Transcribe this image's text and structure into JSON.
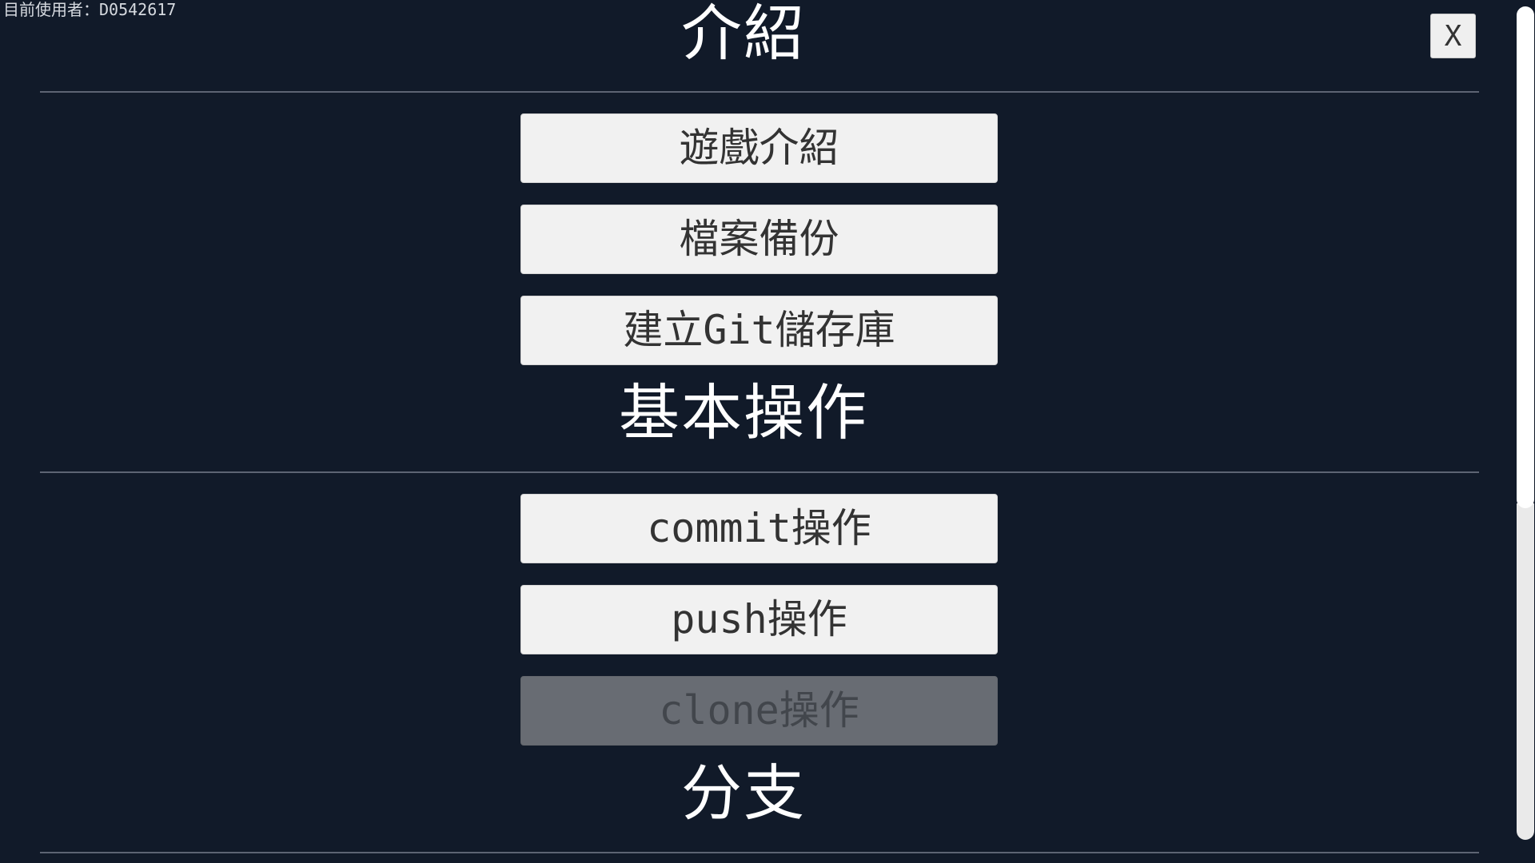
{
  "header": {
    "current_user": "目前使用者：D0542617",
    "close_label": "X"
  },
  "sections": [
    {
      "title": "介紹",
      "buttons": [
        {
          "label": "遊戲介紹",
          "enabled": true
        },
        {
          "label": "檔案備份",
          "enabled": true
        },
        {
          "label": "建立Git儲存庫",
          "enabled": true
        }
      ]
    },
    {
      "title": "基本操作",
      "buttons": [
        {
          "label": "commit操作",
          "enabled": true
        },
        {
          "label": "push操作",
          "enabled": true
        },
        {
          "label": "clone操作",
          "enabled": false
        }
      ]
    },
    {
      "title": "分支",
      "buttons": []
    }
  ],
  "colors": {
    "background": "#111a29",
    "button": "#f1f1f1",
    "button_disabled": "#686c73",
    "divider": "#5d6473"
  }
}
